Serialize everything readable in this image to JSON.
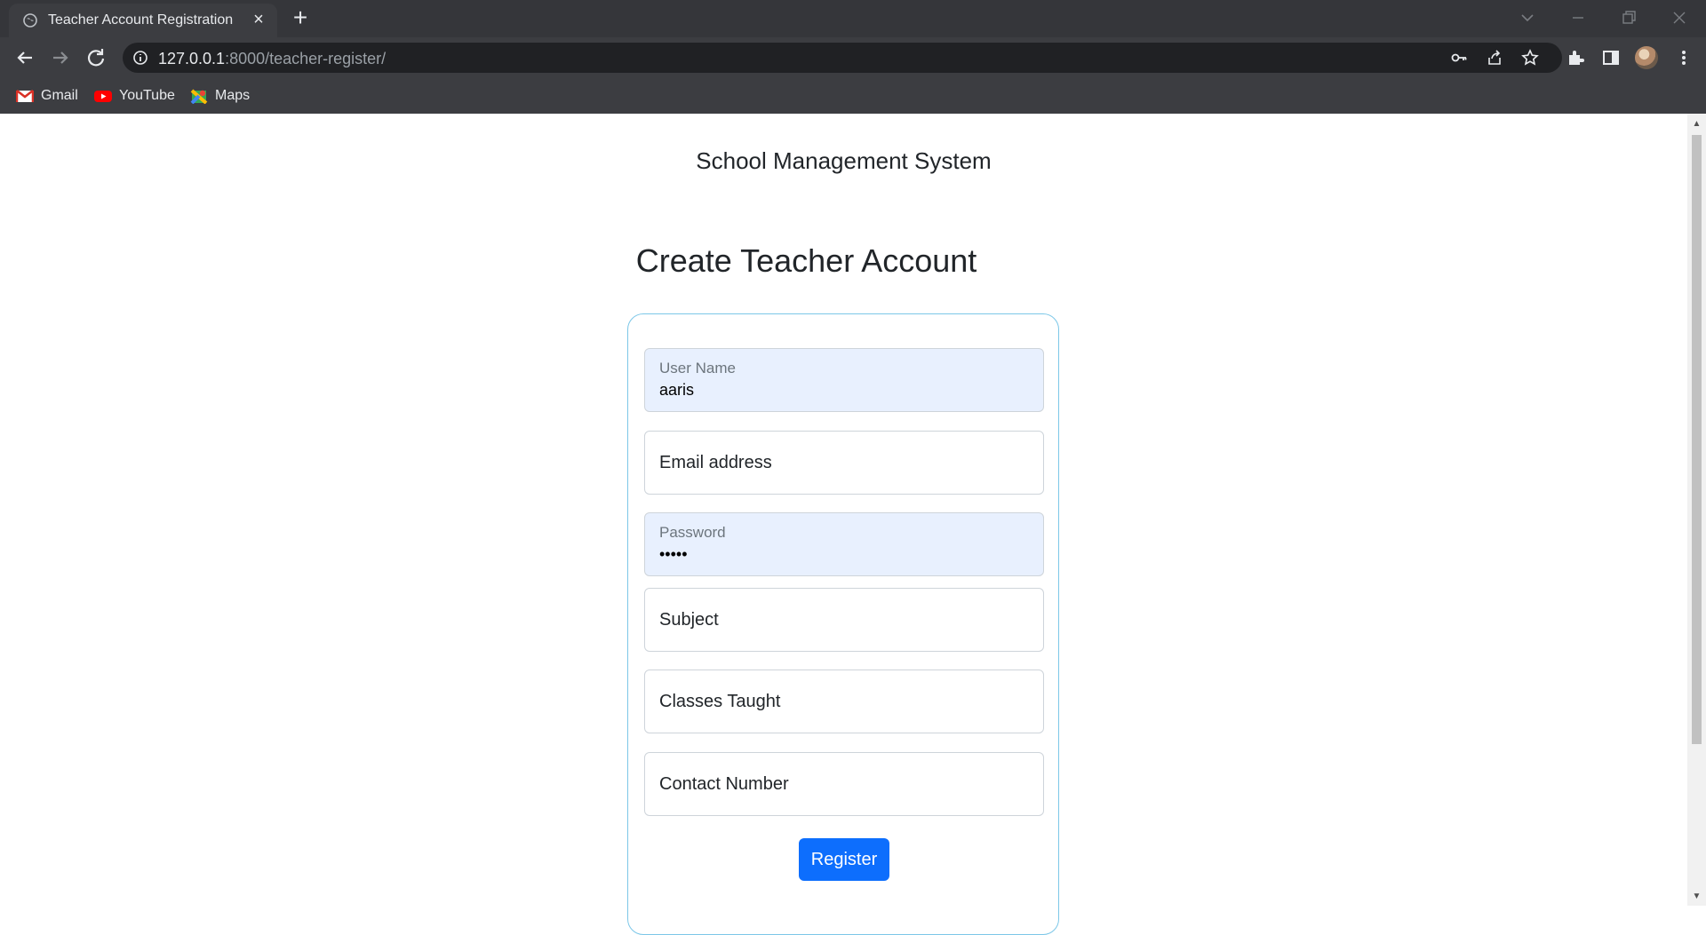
{
  "browser": {
    "tab_title": "Teacher Account Registration",
    "url_host": "127.0.0.1",
    "url_rest": ":8000/teacher-register/",
    "bookmarks": [
      {
        "label": "Gmail",
        "icon": "gmail-icon"
      },
      {
        "label": "YouTube",
        "icon": "youtube-icon"
      },
      {
        "label": "Maps",
        "icon": "maps-icon"
      }
    ]
  },
  "page": {
    "site_title": "School Management System",
    "heading": "Create Teacher Account",
    "form": {
      "username": {
        "label": "User Name",
        "value": "aaris"
      },
      "email": {
        "placeholder": "Email address"
      },
      "password": {
        "label": "Password",
        "value": "•••••"
      },
      "subject": {
        "placeholder": "Subject"
      },
      "classes": {
        "placeholder": "Classes Taught"
      },
      "contact": {
        "placeholder": "Contact Number"
      },
      "submit_label": "Register"
    }
  },
  "colors": {
    "primary": "#0d6efd",
    "card_border": "#7cc7e8",
    "autofill_bg": "#e8f0fe"
  }
}
